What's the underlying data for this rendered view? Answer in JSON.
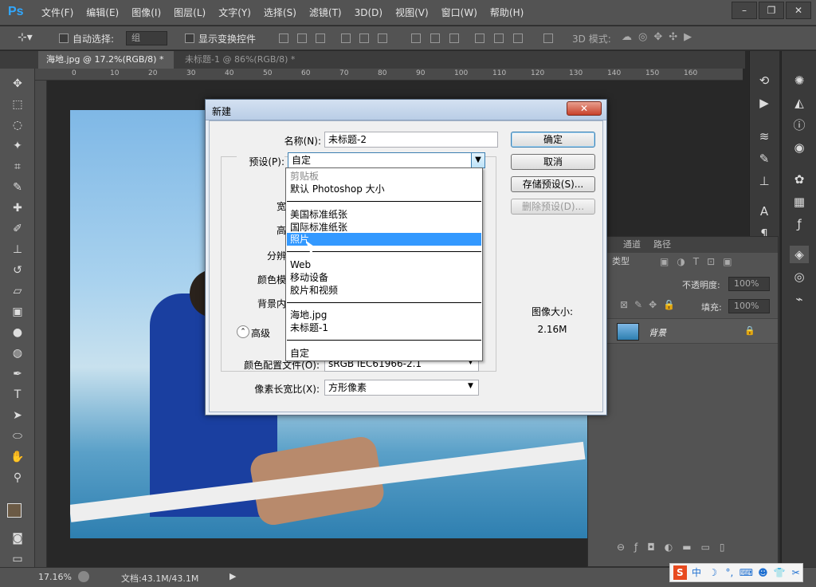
{
  "app": {
    "logo": "Ps"
  },
  "menubar": {
    "items": [
      "文件(F)",
      "编辑(E)",
      "图像(I)",
      "图层(L)",
      "文字(Y)",
      "选择(S)",
      "滤镜(T)",
      "3D(D)",
      "视图(V)",
      "窗口(W)",
      "帮助(H)"
    ]
  },
  "options": {
    "auto_select_label": "自动选择:",
    "auto_select_value": "组",
    "show_transform_label": "显示变换控件",
    "mode_3d_label": "3D 模式:"
  },
  "tabs": [
    {
      "label": "海地.jpg @ 17.2%(RGB/8) *",
      "close": "×"
    },
    {
      "label": "未标题-1 @ 86%(RGB/8) *",
      "close": "×"
    }
  ],
  "ruler": {
    "ticks": [
      "0",
      "10",
      "20",
      "30",
      "40",
      "50",
      "60",
      "70",
      "80",
      "90",
      "100",
      "110",
      "120",
      "130",
      "140",
      "150",
      "160"
    ]
  },
  "dialog": {
    "title": "新建",
    "close": "✕",
    "name_label": "名称(N):",
    "name_value": "未标题-2",
    "preset_label": "预设(P):",
    "preset_value": "自定",
    "width_label": "宽",
    "height_label": "高",
    "resolution_label": "分辨",
    "colormode_label": "颜色模",
    "background_label": "背景内",
    "advanced_label": "高级",
    "color_profile_label": "颜色配置文件(O):",
    "color_profile_value": "sRGB IEC61966-2.1",
    "pixel_aspect_label": "像素长宽比(X):",
    "pixel_aspect_value": "方形像素",
    "image_size_label": "图像大小:",
    "image_size_value": "2.16M",
    "buttons": {
      "ok": "确定",
      "cancel": "取消",
      "save_preset": "存储预设(S)...",
      "delete_preset": "删除预设(D)..."
    }
  },
  "dropdown": {
    "items": [
      {
        "label": "剪贴板",
        "kind": "header"
      },
      {
        "label": "默认 Photoshop 大小",
        "kind": "item"
      },
      {
        "label": "美国标准纸张",
        "kind": "item"
      },
      {
        "label": "国际标准纸张",
        "kind": "item"
      },
      {
        "label": "照片",
        "kind": "selected"
      },
      {
        "label": "Web",
        "kind": "item"
      },
      {
        "label": "移动设备",
        "kind": "item"
      },
      {
        "label": "胶片和视频",
        "kind": "item"
      },
      {
        "label": "海地.jpg",
        "kind": "item"
      },
      {
        "label": "未标题-1",
        "kind": "item"
      },
      {
        "label": "自定",
        "kind": "item"
      }
    ]
  },
  "layers_panel": {
    "tabs": [
      "通道",
      "路径"
    ],
    "kind_label": "类型",
    "opacity_label": "不透明度:",
    "opacity_value": "100%",
    "fill_label": "填充:",
    "fill_value": "100%",
    "layer_name": "背景"
  },
  "status": {
    "zoom": "17.16%",
    "doc": "文档:43.1M/43.1M"
  },
  "ime": {
    "logo": "S",
    "lang": "中"
  }
}
